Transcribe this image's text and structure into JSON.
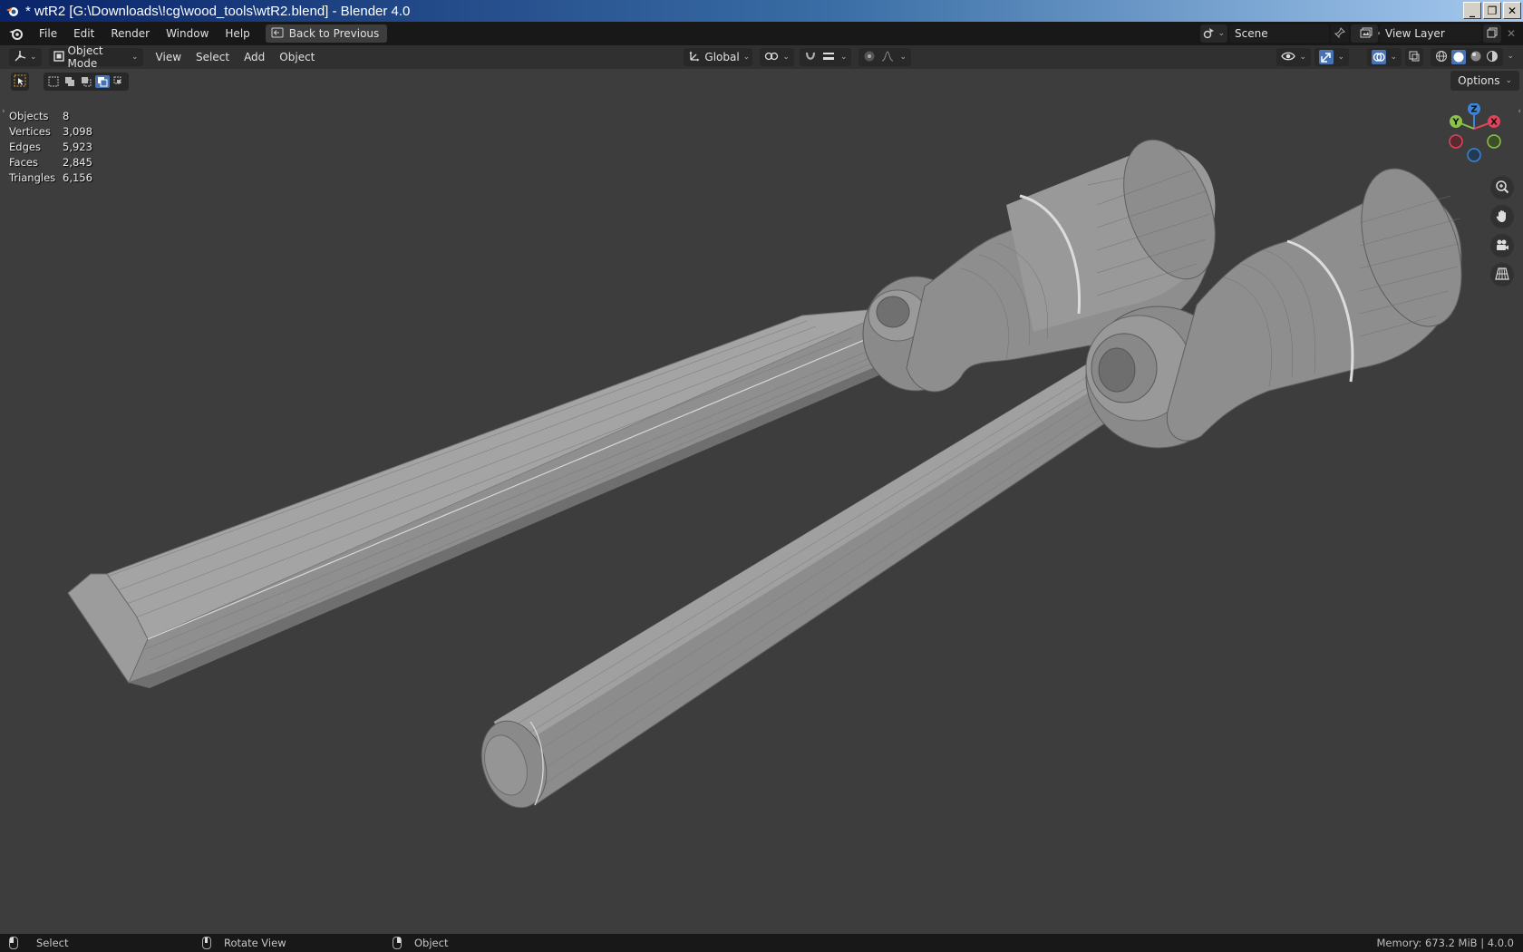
{
  "window": {
    "title": "* wtR2 [G:\\Downloads\\!cg\\wood_tools\\wtR2.blend] - Blender 4.0",
    "controls": [
      "minimize",
      "restore",
      "close"
    ]
  },
  "topbar": {
    "menus": [
      "File",
      "Edit",
      "Render",
      "Window",
      "Help"
    ],
    "back_label": "Back to Previous",
    "scene_name": "Scene",
    "view_layer_name": "View Layer"
  },
  "viewport_header": {
    "mode": "Object Mode",
    "menus": [
      "View",
      "Select",
      "Add",
      "Object"
    ],
    "transform_orientation": "Global"
  },
  "viewport": {
    "options_label": "Options",
    "stats": [
      {
        "label": "Objects",
        "value": "8"
      },
      {
        "label": "Vertices",
        "value": "3,098"
      },
      {
        "label": "Edges",
        "value": "5,923"
      },
      {
        "label": "Faces",
        "value": "2,845"
      },
      {
        "label": "Triangles",
        "value": "6,156"
      }
    ],
    "gizmo_axes": {
      "x": "X",
      "y": "Y",
      "z": "Z"
    },
    "colors": {
      "x": "#e0445a",
      "y": "#8bc34a",
      "z": "#3d85d6",
      "accent": "#4772b3"
    }
  },
  "statusbar": {
    "items": [
      "Select",
      "Rotate View",
      "Object"
    ],
    "memory": "Memory: 673.2 MiB | 4.0.0"
  }
}
